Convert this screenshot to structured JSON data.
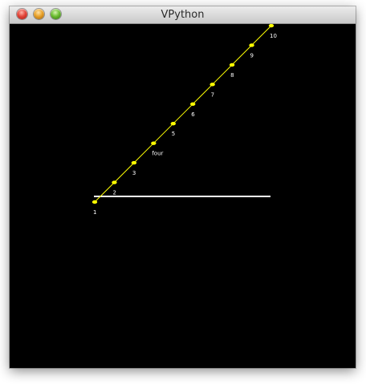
{
  "window": {
    "title": "VPython"
  },
  "colors": {
    "background": "#000000",
    "axis": "#ffffff",
    "curve": "#ffff00",
    "point": "#ffff00",
    "label": "#ffffff"
  },
  "scene": {
    "points": [
      {
        "label": "1"
      },
      {
        "label": "2"
      },
      {
        "label": "3"
      },
      {
        "label": "four"
      },
      {
        "label": "5"
      },
      {
        "label": "6"
      },
      {
        "label": "7"
      },
      {
        "label": "8"
      },
      {
        "label": "9"
      },
      {
        "label": "10"
      }
    ]
  }
}
